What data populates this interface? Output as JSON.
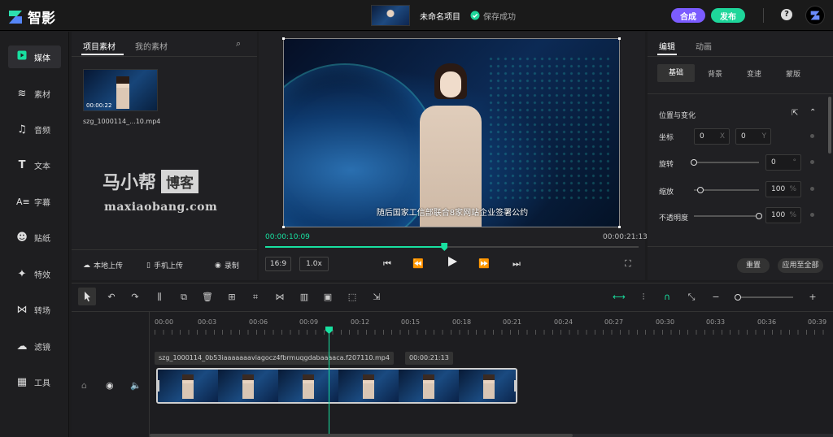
{
  "app": {
    "name": "智影"
  },
  "header": {
    "project_name": "未命名项目",
    "save_status": "保存成功",
    "compose_label": "合成",
    "publish_label": "发布",
    "help": "?"
  },
  "sidebar": {
    "items": [
      {
        "label": "媒体",
        "icon": "play-square-icon"
      },
      {
        "label": "素材",
        "icon": "layers-icon"
      },
      {
        "label": "音频",
        "icon": "music-note-icon"
      },
      {
        "label": "文本",
        "icon": "text-t-icon"
      },
      {
        "label": "字幕",
        "icon": "subtitle-icon"
      },
      {
        "label": "贴纸",
        "icon": "smiley-icon"
      },
      {
        "label": "特效",
        "icon": "sparkle-icon"
      },
      {
        "label": "转场",
        "icon": "transition-icon"
      },
      {
        "label": "滤镜",
        "icon": "filter-icon"
      },
      {
        "label": "工具",
        "icon": "grid-icon"
      }
    ]
  },
  "media": {
    "tabs": [
      "项目素材",
      "我的素材"
    ],
    "clip": {
      "duration": "00:00:22",
      "filename": "szg_1000114_...10.mp4"
    },
    "watermark": {
      "cn": "马小帮",
      "tag": "博客",
      "url": "maxiaobang.com"
    },
    "buttons": {
      "local_upload": "本地上传",
      "phone_upload": "手机上传",
      "record": "录制"
    }
  },
  "preview": {
    "subtitle": "随后国家工信部联合8家网站企业签署公约",
    "current_time": "00:00:10:09",
    "total_time": "00:00:21:13",
    "progress": 0.48,
    "ratio": "16:9",
    "speed": "1.0x"
  },
  "props": {
    "tabs": [
      "编辑",
      "动画"
    ],
    "subtabs": [
      "基础",
      "背景",
      "变速",
      "蒙版"
    ],
    "section_title": "位置与变化",
    "position": {
      "label": "坐标",
      "x": "0",
      "x_unit": "X",
      "y": "0",
      "y_unit": "Y"
    },
    "rotation": {
      "label": "旋转",
      "value": "0",
      "unit": "°",
      "level": 0
    },
    "scale": {
      "label": "缩放",
      "value": "100",
      "unit": "%",
      "level": 0.1
    },
    "opacity": {
      "label": "不透明度",
      "value": "100",
      "unit": "%",
      "level": 1.0
    },
    "reset_label": "重置",
    "apply_all_label": "应用至全部"
  },
  "timeline": {
    "ruler": [
      "00:00",
      "00:03",
      "00:06",
      "00:09",
      "00:12",
      "00:15",
      "00:18",
      "00:21",
      "00:24",
      "00:27",
      "00:30",
      "00:33",
      "00:36",
      "00:39"
    ],
    "playhead_time": "00:09",
    "clip": {
      "name": "szg_1000114_0b53iaaaaaaaviagocz4fbrmuqgdabaaaaca.f207110.mp4",
      "duration": "00:00:21:13"
    }
  },
  "colors": {
    "accent": "#18e0a0",
    "compose": "#7b5cff",
    "publish": "#1ed69a",
    "background": "#1c1c1e"
  }
}
